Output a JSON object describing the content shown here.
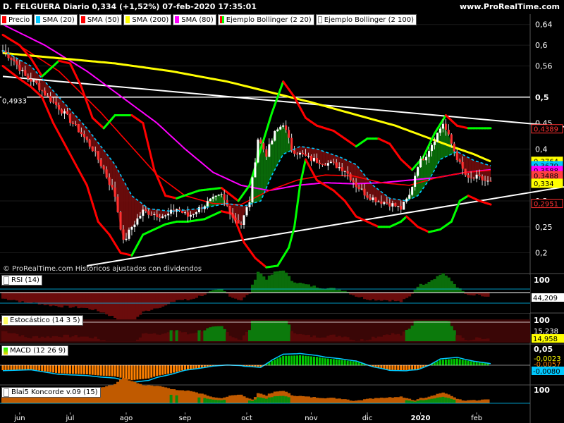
{
  "header": {
    "title": "D. FELGUERA Diario 0,334 (+1,52%) 07-feb-2020 17:35:01",
    "site": "www.ProRealTime.com"
  },
  "legend": [
    {
      "label": "Precio",
      "color": "#ff0000"
    },
    {
      "label": "SMA (20)",
      "color": "#00c8ff"
    },
    {
      "label": "SMA (50)",
      "color": "#ff0000"
    },
    {
      "label": "SMA (200)",
      "color": "#ffff00"
    },
    {
      "label": "SMA (80)",
      "color": "#ff00ff"
    },
    {
      "label": "Ejemplo Bollinger (2 20)",
      "color": "#ff0000",
      "color2": "#00ff00"
    },
    {
      "label": "Ejemplo Bollinger (2 100)",
      "color": "#ffffff"
    }
  ],
  "copyright": "© ProRealTime.com  Históricos ajustados con dividendos",
  "chart_data": {
    "type": "line",
    "title": "D. FELGUERA Diario 0,334 (+1,52%) 07-feb-2020 17:35:01",
    "ylim": [
      0.16,
      0.66
    ],
    "y_ticks": [
      "0,64",
      "0,6",
      "0,56",
      "0,5",
      "0,45",
      "0,4",
      "0,35",
      "0,3",
      "0,25",
      "0,2"
    ],
    "y_tick_values": [
      0.64,
      0.6,
      0.56,
      0.5,
      0.45,
      0.4,
      0.35,
      0.3,
      0.25,
      0.2
    ],
    "x_ticks": [
      "jun",
      "jul",
      "ago",
      "sep",
      "oct",
      "nov",
      "dic",
      "2020",
      "feb"
    ],
    "x_tick_index": [
      6,
      24,
      44,
      65,
      87,
      110,
      130,
      149,
      169
    ],
    "n_days": 175,
    "price_key": [
      [
        0,
        0.59
      ],
      [
        4,
        0.57
      ],
      [
        8,
        0.54
      ],
      [
        12,
        0.525
      ],
      [
        16,
        0.5
      ],
      [
        20,
        0.48
      ],
      [
        24,
        0.455
      ],
      [
        28,
        0.43
      ],
      [
        32,
        0.4
      ],
      [
        36,
        0.36
      ],
      [
        40,
        0.31
      ],
      [
        43,
        0.22
      ],
      [
        46,
        0.25
      ],
      [
        50,
        0.28
      ],
      [
        54,
        0.275
      ],
      [
        58,
        0.27
      ],
      [
        62,
        0.285
      ],
      [
        66,
        0.27
      ],
      [
        70,
        0.285
      ],
      [
        74,
        0.3
      ],
      [
        78,
        0.31
      ],
      [
        82,
        0.27
      ],
      [
        85,
        0.255
      ],
      [
        88,
        0.3
      ],
      [
        91,
        0.42
      ],
      [
        94,
        0.39
      ],
      [
        97,
        0.43
      ],
      [
        100,
        0.45
      ],
      [
        103,
        0.4
      ],
      [
        106,
        0.39
      ],
      [
        110,
        0.38
      ],
      [
        114,
        0.375
      ],
      [
        118,
        0.37
      ],
      [
        122,
        0.36
      ],
      [
        126,
        0.33
      ],
      [
        130,
        0.31
      ],
      [
        134,
        0.3
      ],
      [
        138,
        0.295
      ],
      [
        142,
        0.285
      ],
      [
        145,
        0.31
      ],
      [
        148,
        0.37
      ],
      [
        151,
        0.39
      ],
      [
        154,
        0.42
      ],
      [
        157,
        0.45
      ],
      [
        160,
        0.41
      ],
      [
        163,
        0.37
      ],
      [
        166,
        0.34
      ],
      [
        169,
        0.345
      ],
      [
        174,
        0.334
      ]
    ],
    "sma20_key": [
      [
        0,
        0.59
      ],
      [
        10,
        0.56
      ],
      [
        20,
        0.5
      ],
      [
        30,
        0.44
      ],
      [
        40,
        0.37
      ],
      [
        46,
        0.31
      ],
      [
        52,
        0.285
      ],
      [
        60,
        0.28
      ],
      [
        70,
        0.285
      ],
      [
        80,
        0.295
      ],
      [
        86,
        0.29
      ],
      [
        92,
        0.3
      ],
      [
        96,
        0.35
      ],
      [
        100,
        0.39
      ],
      [
        106,
        0.405
      ],
      [
        112,
        0.4
      ],
      [
        120,
        0.385
      ],
      [
        126,
        0.37
      ],
      [
        132,
        0.33
      ],
      [
        138,
        0.305
      ],
      [
        144,
        0.3
      ],
      [
        148,
        0.31
      ],
      [
        152,
        0.34
      ],
      [
        156,
        0.38
      ],
      [
        162,
        0.395
      ],
      [
        168,
        0.378
      ],
      [
        174,
        0.3676
      ]
    ],
    "sma50_key": [
      [
        0,
        0.62
      ],
      [
        20,
        0.55
      ],
      [
        35,
        0.47
      ],
      [
        45,
        0.41
      ],
      [
        55,
        0.35
      ],
      [
        65,
        0.31
      ],
      [
        75,
        0.295
      ],
      [
        85,
        0.293
      ],
      [
        95,
        0.32
      ],
      [
        105,
        0.34
      ],
      [
        115,
        0.35
      ],
      [
        125,
        0.348
      ],
      [
        135,
        0.335
      ],
      [
        145,
        0.33
      ],
      [
        155,
        0.345
      ],
      [
        165,
        0.355
      ],
      [
        174,
        0.3588
      ]
    ],
    "sma80_key": [
      [
        0,
        0.64
      ],
      [
        15,
        0.6
      ],
      [
        30,
        0.55
      ],
      [
        45,
        0.49
      ],
      [
        55,
        0.45
      ],
      [
        65,
        0.4
      ],
      [
        75,
        0.355
      ],
      [
        85,
        0.33
      ],
      [
        95,
        0.32
      ],
      [
        105,
        0.33
      ],
      [
        115,
        0.335
      ],
      [
        125,
        0.333
      ],
      [
        135,
        0.335
      ],
      [
        145,
        0.34
      ],
      [
        155,
        0.345
      ],
      [
        165,
        0.355
      ],
      [
        174,
        0.36
      ]
    ],
    "sma200_key": [
      [
        0,
        0.585
      ],
      [
        20,
        0.575
      ],
      [
        40,
        0.565
      ],
      [
        60,
        0.55
      ],
      [
        80,
        0.53
      ],
      [
        95,
        0.51
      ],
      [
        110,
        0.49
      ],
      [
        120,
        0.475
      ],
      [
        130,
        0.46
      ],
      [
        140,
        0.445
      ],
      [
        150,
        0.425
      ],
      [
        160,
        0.405
      ],
      [
        168,
        0.39
      ],
      [
        174,
        0.376
      ]
    ],
    "boll_upper_key": [
      [
        0,
        0.62
      ],
      [
        6,
        0.6
      ],
      [
        10,
        0.575
      ],
      [
        14,
        0.54
      ],
      [
        20,
        0.57
      ],
      [
        24,
        0.565
      ],
      [
        28,
        0.52
      ],
      [
        32,
        0.46
      ],
      [
        36,
        0.44
      ],
      [
        40,
        0.465
      ],
      [
        46,
        0.465
      ],
      [
        50,
        0.45
      ],
      [
        54,
        0.36
      ],
      [
        58,
        0.31
      ],
      [
        62,
        0.305
      ],
      [
        70,
        0.32
      ],
      [
        78,
        0.325
      ],
      [
        84,
        0.3
      ],
      [
        88,
        0.33
      ],
      [
        92,
        0.4
      ],
      [
        96,
        0.47
      ],
      [
        100,
        0.53
      ],
      [
        104,
        0.5
      ],
      [
        108,
        0.46
      ],
      [
        112,
        0.445
      ],
      [
        118,
        0.435
      ],
      [
        122,
        0.42
      ],
      [
        126,
        0.405
      ],
      [
        130,
        0.42
      ],
      [
        134,
        0.42
      ],
      [
        138,
        0.41
      ],
      [
        142,
        0.38
      ],
      [
        146,
        0.36
      ],
      [
        150,
        0.385
      ],
      [
        154,
        0.43
      ],
      [
        158,
        0.465
      ],
      [
        162,
        0.445
      ],
      [
        166,
        0.44
      ],
      [
        170,
        0.44
      ],
      [
        174,
        0.44
      ]
    ],
    "boll_lower_key": [
      [
        0,
        0.56
      ],
      [
        6,
        0.535
      ],
      [
        10,
        0.52
      ],
      [
        14,
        0.5
      ],
      [
        18,
        0.45
      ],
      [
        22,
        0.41
      ],
      [
        26,
        0.37
      ],
      [
        30,
        0.33
      ],
      [
        34,
        0.26
      ],
      [
        38,
        0.235
      ],
      [
        42,
        0.2
      ],
      [
        46,
        0.195
      ],
      [
        50,
        0.235
      ],
      [
        54,
        0.245
      ],
      [
        58,
        0.255
      ],
      [
        62,
        0.26
      ],
      [
        66,
        0.26
      ],
      [
        72,
        0.265
      ],
      [
        78,
        0.28
      ],
      [
        82,
        0.275
      ],
      [
        86,
        0.22
      ],
      [
        90,
        0.19
      ],
      [
        94,
        0.172
      ],
      [
        98,
        0.175
      ],
      [
        102,
        0.21
      ],
      [
        104,
        0.25
      ],
      [
        106,
        0.33
      ],
      [
        108,
        0.38
      ],
      [
        112,
        0.34
      ],
      [
        118,
        0.32
      ],
      [
        122,
        0.3
      ],
      [
        126,
        0.27
      ],
      [
        130,
        0.26
      ],
      [
        134,
        0.25
      ],
      [
        138,
        0.25
      ],
      [
        142,
        0.26
      ],
      [
        144,
        0.27
      ],
      [
        148,
        0.25
      ],
      [
        152,
        0.24
      ],
      [
        156,
        0.245
      ],
      [
        160,
        0.26
      ],
      [
        163,
        0.3
      ],
      [
        166,
        0.31
      ],
      [
        170,
        0.3
      ],
      [
        174,
        0.293
      ]
    ],
    "trendline_upper": [
      [
        0,
        0.54
      ],
      [
        174,
        0.435
      ]
    ],
    "trendline_lower": [
      [
        30,
        0.175
      ],
      [
        174,
        0.315
      ]
    ],
    "hline": 0.5,
    "hline_label": "0,4933",
    "price_labels": [
      {
        "text": "0,4389",
        "value": 0.4389,
        "bg": "#000000",
        "fg": "#ff3030",
        "border": "#ff3030"
      },
      {
        "text": "0,3764",
        "value": 0.3764,
        "bg": "#ffff00",
        "fg": "#000000",
        "border": "#ffff00"
      },
      {
        "text": "0,3679",
        "value": 0.3679,
        "bg": "#00c8ff",
        "fg": "#000000",
        "border": "#00c8ff"
      },
      {
        "text": "0,3588",
        "value": 0.3588,
        "bg": "#ff00ff",
        "fg": "#000000",
        "border": "#ff00ff"
      },
      {
        "text": "0,3488",
        "value": 0.3488,
        "bg": "#ff4040",
        "fg": "#000000",
        "border": "#ff4040"
      },
      {
        "text": "0,334",
        "value": 0.334,
        "bg": "#ffff00",
        "fg": "#000000",
        "border": "#ffff00"
      },
      {
        "text": "0,2951",
        "value": 0.2951,
        "bg": "#000000",
        "fg": "#ff3030",
        "border": "#ff3030"
      }
    ],
    "panels": [
      {
        "name": "RSI (14)",
        "ticks": [
          "100"
        ],
        "value_label": "44,209",
        "value_bg": "#ffffff",
        "value_fg": "#000000"
      },
      {
        "name": "Estocástico (14 3 5)",
        "ticks": [
          "100"
        ],
        "value_label": "14,958",
        "value_bg": "#ffff00",
        "value_fg": "#000000",
        "extra_label": "15,238"
      },
      {
        "name": "MACD (12 26 9)",
        "ticks": [
          "0,05"
        ],
        "value_label": "-0,0080",
        "value_bg": "#00c8ff",
        "value_fg": "#000000",
        "extra_label": "-0,0023",
        "extra_label2": "-0,0057"
      },
      {
        "name": "Blai5 Koncorde v.09 (15)",
        "ticks": [
          "100"
        ],
        "value_label": "",
        "value_bg": "#00c8ff",
        "value_fg": "#000000"
      }
    ]
  }
}
